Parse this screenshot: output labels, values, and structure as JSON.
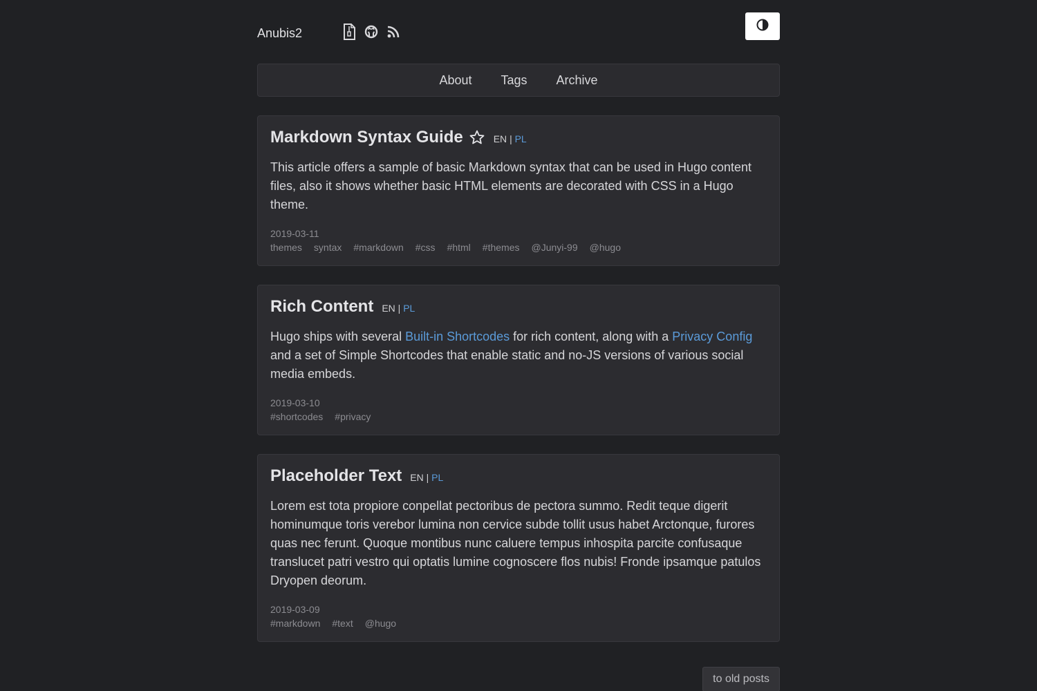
{
  "site": {
    "title": "Anubis2",
    "social_icons": [
      "resume-icon",
      "github-icon",
      "rss-icon"
    ],
    "theme_toggle_icon": "contrast-icon"
  },
  "nav": {
    "items": [
      {
        "label": "About"
      },
      {
        "label": "Tags"
      },
      {
        "label": "Archive"
      }
    ]
  },
  "posts": [
    {
      "title": "Markdown Syntax Guide",
      "starred": true,
      "lang_current": "EN",
      "lang_sep": "|",
      "lang_other": "PL",
      "summary": "This article offers a sample of basic Markdown syntax that can be used in Hugo content files, also it shows whether basic HTML elements are decorated with CSS in a Hugo theme.",
      "date": "2019-03-11",
      "tags": [
        "themes",
        "syntax",
        "#markdown",
        "#css",
        "#html",
        "#themes",
        "@Junyi-99",
        "@hugo"
      ]
    },
    {
      "title": "Rich Content",
      "starred": false,
      "lang_current": "EN",
      "lang_sep": "|",
      "lang_other": "PL",
      "summary_parts": {
        "p1": "Hugo ships with several ",
        "link1": "Built-in Shortcodes",
        "p2": " for rich content, along with a ",
        "link2": "Privacy Config",
        "p3": " and a set of Simple Shortcodes that enable static and no-JS versions of various social media embeds."
      },
      "date": "2019-03-10",
      "tags": [
        "#shortcodes",
        "#privacy"
      ]
    },
    {
      "title": "Placeholder Text",
      "starred": false,
      "lang_current": "EN",
      "lang_sep": "|",
      "lang_other": "PL",
      "summary": "Lorem est tota propiore conpellat pectoribus de pectora summo. Redit teque digerit hominumque toris verebor lumina non cervice subde tollit usus habet Arctonque, furores quas nec ferunt. Quoque montibus nunc caluere tempus inhospita parcite confusaque translucet patri vestro qui optatis lumine cognoscere flos nubis! Fronde ipsamque patulos Dryopen deorum.",
      "date": "2019-03-09",
      "tags": [
        "#markdown",
        "#text",
        "@hugo"
      ]
    }
  ],
  "pager": {
    "label": "to old posts"
  },
  "colors": {
    "background": "#202124",
    "card": "#2c2c30",
    "link": "#5b9bd9",
    "muted": "#8c8c91"
  }
}
